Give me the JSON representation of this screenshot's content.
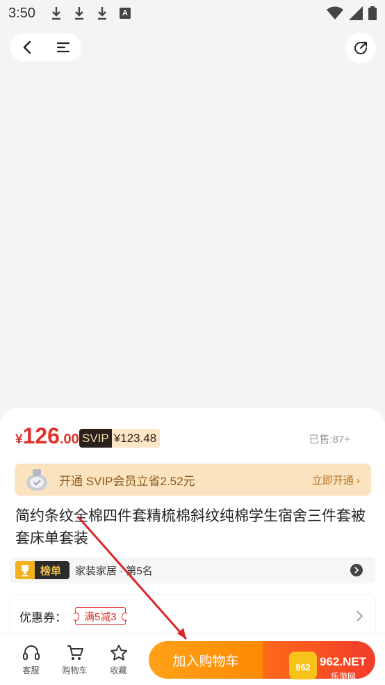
{
  "status_bar": {
    "time": "3:50",
    "icons": [
      "download-icon",
      "download-icon",
      "download-icon",
      "a-notification-icon",
      "wifi-icon",
      "signal-icon",
      "battery-icon"
    ],
    "a_letter": "A"
  },
  "nav": {
    "icons": [
      "back-icon",
      "menu-icon",
      "share-icon"
    ]
  },
  "product": {
    "price_currency": "¥",
    "price_int": "126",
    "price_dec": ".00",
    "svip_tag": "SVIP",
    "svip_price": "¥123.48",
    "sold": "已售:87+",
    "vip_banner_text": "开通 SVIP会员立省2.52元",
    "vip_banner_link": "立即开通 ›",
    "title": "简约条纹全棉四件套精梳棉斜纹纯棉学生宿舍三件套被套床单套装",
    "rank_badge": "榜单",
    "rank_text": "家装家居 · 第5名",
    "coupon_label": "优惠券：",
    "coupon_tag": "满5减3"
  },
  "bottom_bar": {
    "tabs": [
      {
        "label": "客服",
        "icon": "headset-icon"
      },
      {
        "label": "购物车",
        "icon": "cart-icon"
      },
      {
        "label": "收藏",
        "icon": "star-icon"
      }
    ],
    "add_to_cart": "加入购物车"
  },
  "watermark": {
    "text": "962.NET",
    "sub": "乐游网"
  },
  "colors": {
    "price_red": "#e0312a",
    "cart_orange": "#ff9a10",
    "buy_red": "#f23b2a",
    "vip_bg": "#fbe3c0"
  }
}
